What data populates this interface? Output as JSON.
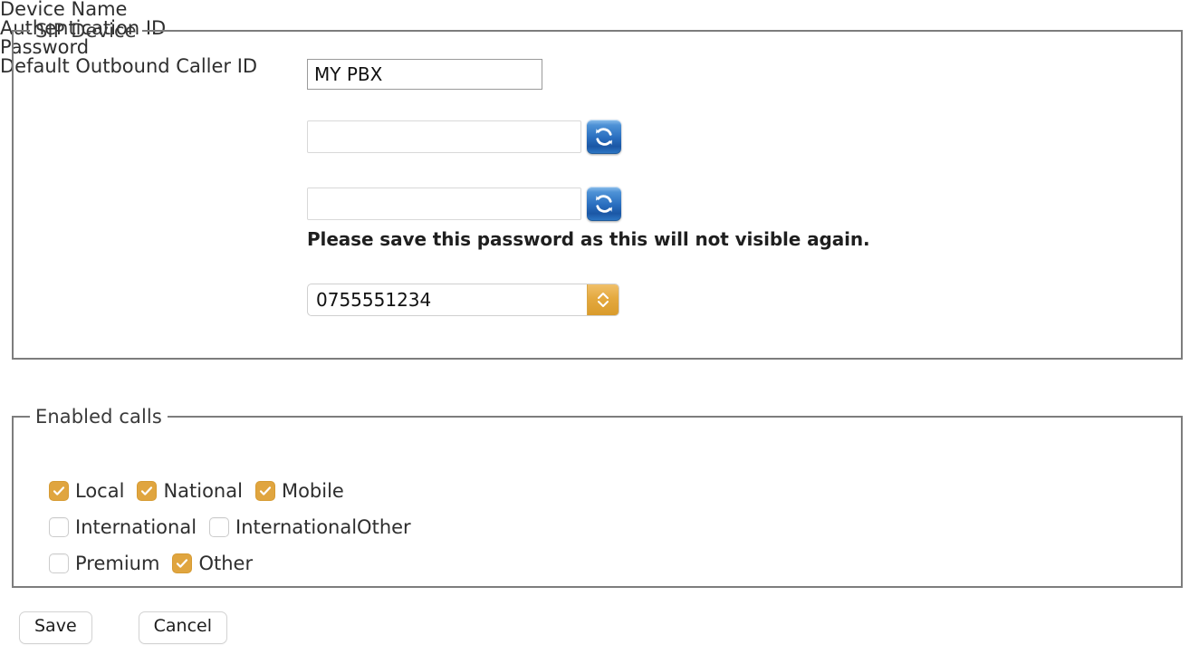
{
  "sip_device": {
    "legend": "SIP Device",
    "fields": {
      "device_name": {
        "label": "Device Name",
        "value": "MY PBX",
        "placeholder": ""
      },
      "authentication_id": {
        "label": "Authentication ID",
        "value": "",
        "placeholder": "",
        "refresh_icon": "refresh-icon"
      },
      "password": {
        "label": "Password",
        "value": "",
        "placeholder": "",
        "refresh_icon": "refresh-icon",
        "warning": "Please save this password as this will not visible again."
      },
      "default_outbound_caller_id": {
        "label": "Default Outbound Caller ID",
        "selected": "0755551234",
        "arrow_icon": "chevron-up-down-icon"
      }
    }
  },
  "enabled_calls": {
    "legend": "Enabled calls",
    "rows": [
      [
        {
          "label": "Local",
          "checked": true
        },
        {
          "label": "National",
          "checked": true
        },
        {
          "label": "Mobile",
          "checked": true
        }
      ],
      [
        {
          "label": "International",
          "checked": false
        },
        {
          "label": "InternationalOther",
          "checked": false
        }
      ],
      [
        {
          "label": "Premium",
          "checked": false
        },
        {
          "label": "Other",
          "checked": true
        }
      ]
    ]
  },
  "actions": {
    "save_label": "Save",
    "cancel_label": "Cancel"
  },
  "colors": {
    "accent_orange": "#e0a53f",
    "refresh_blue": "#2a6fc0",
    "border_gray": "#7d7d7d"
  }
}
